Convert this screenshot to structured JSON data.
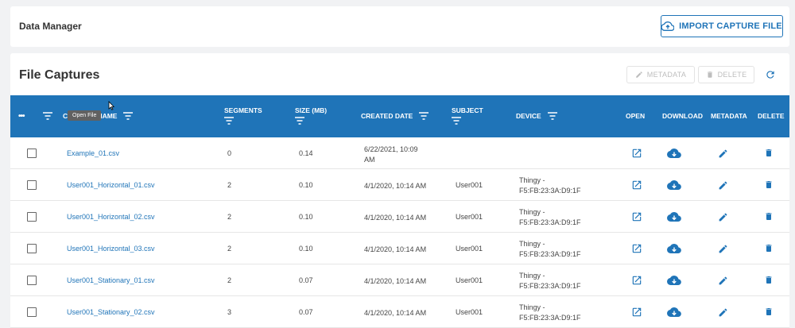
{
  "header": {
    "title": "Data Manager",
    "import_label": "IMPORT CAPTURE FILE"
  },
  "captures": {
    "title": "File Captures",
    "metadata_label": "METADATA",
    "delete_label": "DELETE",
    "columns": {
      "menu": "•••",
      "capture_name": "CAPTURE NAME",
      "segments": "SEGMENTS",
      "size": "SIZE (MB)",
      "created": "CREATED DATE",
      "subject": "SUBJECT",
      "device": "DEVICE",
      "open": "OPEN",
      "download": "DOWNLOAD",
      "metadata": "METADATA",
      "delete": "DELETE"
    },
    "rows": [
      {
        "name": "Example_01.csv",
        "segments": "0",
        "size": "0.14",
        "created_l1": "6/22/2021, 10:09",
        "created_l2": "AM",
        "subject": "",
        "device_l1": "",
        "device_l2": ""
      },
      {
        "name": "User001_Horizontal_01.csv",
        "segments": "2",
        "size": "0.10",
        "created_l1": "4/1/2020, 10:14 AM",
        "created_l2": "",
        "subject": "User001",
        "device_l1": "Thingy -",
        "device_l2": "F5:FB:23:3A:D9:1F"
      },
      {
        "name": "User001_Horizontal_02.csv",
        "segments": "2",
        "size": "0.10",
        "created_l1": "4/1/2020, 10:14 AM",
        "created_l2": "",
        "subject": "User001",
        "device_l1": "Thingy -",
        "device_l2": "F5:FB:23:3A:D9:1F"
      },
      {
        "name": "User001_Horizontal_03.csv",
        "segments": "2",
        "size": "0.10",
        "created_l1": "4/1/2020, 10:14 AM",
        "created_l2": "",
        "subject": "User001",
        "device_l1": "Thingy -",
        "device_l2": "F5:FB:23:3A:D9:1F"
      },
      {
        "name": "User001_Stationary_01.csv",
        "segments": "2",
        "size": "0.07",
        "created_l1": "4/1/2020, 10:14 AM",
        "created_l2": "",
        "subject": "User001",
        "device_l1": "Thingy -",
        "device_l2": "F5:FB:23:3A:D9:1F"
      },
      {
        "name": "User001_Stationary_02.csv",
        "segments": "3",
        "size": "0.07",
        "created_l1": "4/1/2020, 10:14 AM",
        "created_l2": "",
        "subject": "User001",
        "device_l1": "Thingy -",
        "device_l2": "F5:FB:23:3A:D9:1F"
      }
    ],
    "tooltip": "Open File"
  },
  "colors": {
    "accent": "#1f74b8",
    "header_bg": "#1f74b8"
  }
}
